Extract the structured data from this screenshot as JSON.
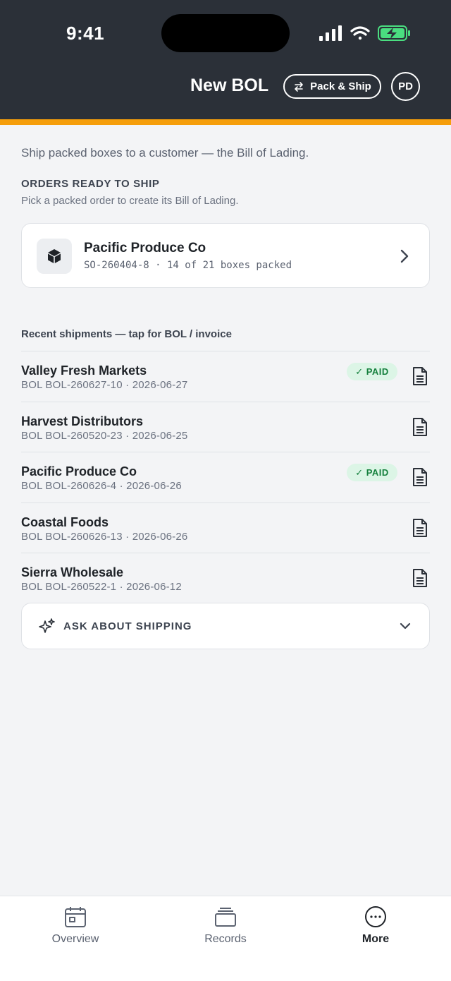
{
  "status_bar": {
    "time": "9:41"
  },
  "header": {
    "title": "New BOL",
    "pack_ship_label": "Pack & Ship",
    "avatar_initials": "PD",
    "accent_color": "#f59e0b",
    "background_color": "#2b3038"
  },
  "intro": "Ship packed boxes to a customer — the Bill of Lading.",
  "orders_section": {
    "heading": "ORDERS READY TO SHIP",
    "subheading": "Pick a packed order to create its Bill of Lading.",
    "orders": [
      {
        "name": "Pacific Produce Co",
        "meta": "SO-260404-8 · 14 of 21 boxes packed",
        "icon": "box-icon"
      }
    ]
  },
  "recent": {
    "heading": "Recent shipments — tap for BOL / invoice",
    "shipments": [
      {
        "name": "Valley Fresh Markets",
        "meta": "BOL BOL-260627-10 · 2026-06-27",
        "badge": "PAID"
      },
      {
        "name": "Harvest Distributors",
        "meta": "BOL BOL-260520-23 · 2026-06-25",
        "badge": ""
      },
      {
        "name": "Pacific Produce Co",
        "meta": "BOL BOL-260626-4 · 2026-06-26",
        "badge": "PAID"
      },
      {
        "name": "Coastal Foods",
        "meta": "BOL BOL-260626-13 · 2026-06-26",
        "badge": ""
      },
      {
        "name": "Sierra Wholesale",
        "meta": "BOL BOL-260522-1 · 2026-06-12",
        "badge": ""
      }
    ]
  },
  "ask": {
    "label": "ASK ABOUT SHIPPING"
  },
  "tabbar": {
    "items": [
      {
        "label": "Overview",
        "icon": "calendar-icon",
        "active": false
      },
      {
        "label": "Records",
        "icon": "stack-icon",
        "active": false
      },
      {
        "label": "More",
        "icon": "more-icon",
        "active": true
      }
    ]
  },
  "colors": {
    "paid_badge_bg": "#dcf5e6",
    "paid_badge_text": "#15803d"
  }
}
